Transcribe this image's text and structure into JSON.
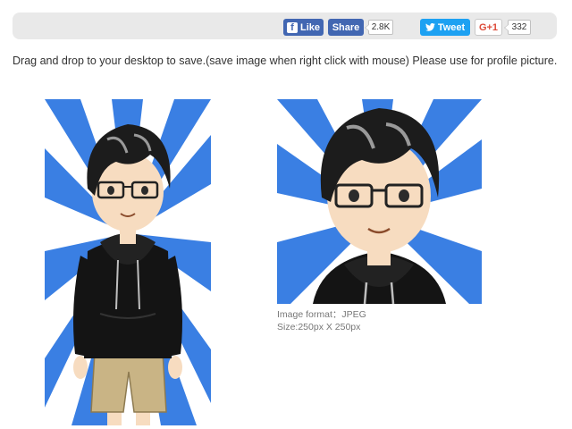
{
  "social": {
    "like_label": "Like",
    "share_label": "Share",
    "share_count": "2.8K",
    "tweet_label": "Tweet",
    "gplus_label": "G+1",
    "gplus_count": "332"
  },
  "instructions": "Drag and drop to your desktop to save.(save image when right click with mouse) Please use for profile picture.",
  "image_info": {
    "format_line": "Image format：JPEG",
    "size_line": "Size:250px X 250px"
  },
  "colors": {
    "burst_blue": "#3a7fe3",
    "hoodie": "#141414",
    "skin": "#f7dcc0",
    "hair": "#1c1c1c",
    "shorts": "#c9b485"
  }
}
